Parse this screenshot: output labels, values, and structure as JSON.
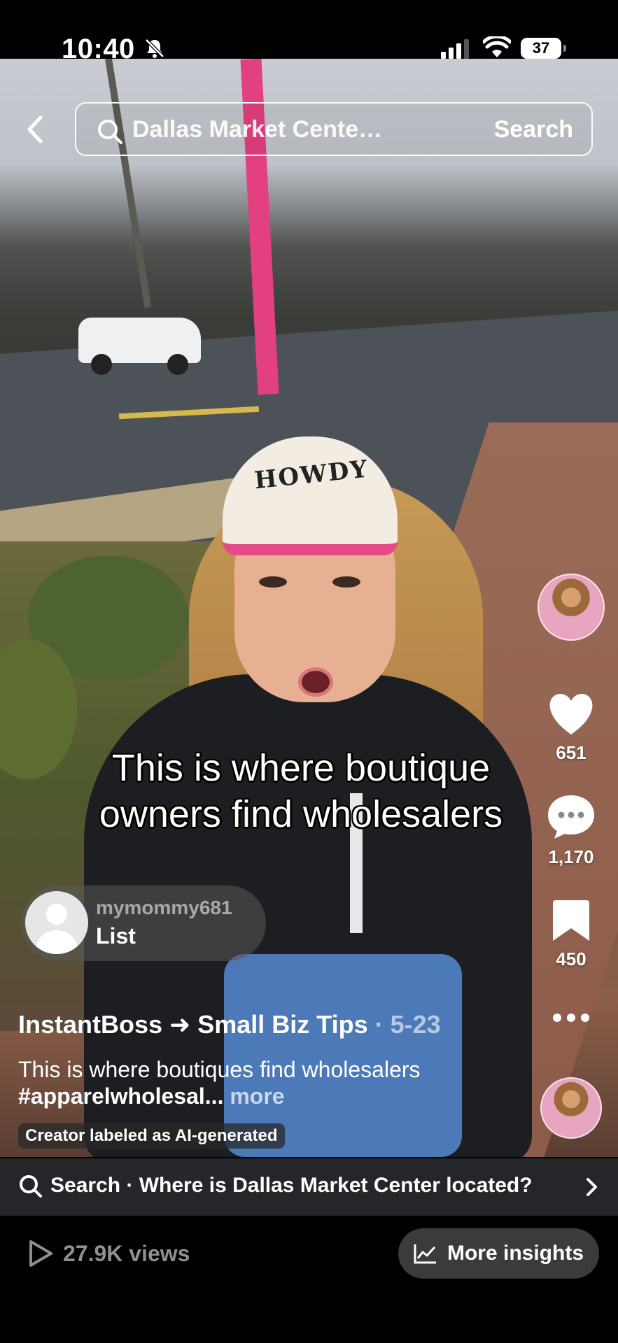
{
  "status_bar": {
    "time": "10:40",
    "battery": "37"
  },
  "search": {
    "query": "Dallas Market Center set...",
    "submit_label": "Search"
  },
  "video": {
    "cap_text": "HOWDY",
    "overlay_caption": "This is where boutique owners find wholesalers"
  },
  "rail": {
    "likes": "651",
    "comments": "1,170",
    "saves": "450"
  },
  "collab": {
    "username": "mymommy681",
    "label": "List"
  },
  "post": {
    "author": "InstantBoss ➜ Small Biz Tips",
    "date": " · 5-23",
    "caption_text": "This is where boutiques find wholesalers ",
    "caption_tag": "#apparelwholesal...",
    "caption_more": " more",
    "ai_label": "Creator labeled as AI-generated"
  },
  "suggestion": {
    "text": "Search · Where is Dallas Market Center located?"
  },
  "stats": {
    "views": "27.9K views",
    "insights_label": "More insights"
  }
}
